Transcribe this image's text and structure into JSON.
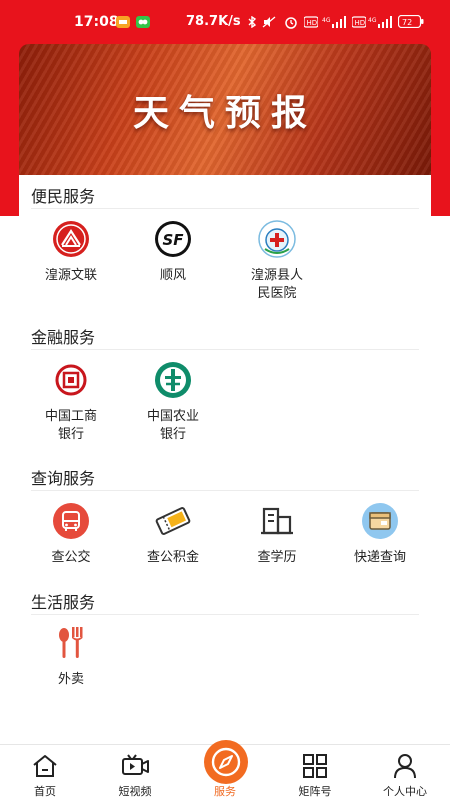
{
  "status_bar": {
    "time": "17:08",
    "right_text": "78.7K/s",
    "battery": "72"
  },
  "banner": {
    "title": "天气预报"
  },
  "sections": [
    {
      "title": "便民服务",
      "items": [
        {
          "label": "湟源文联",
          "icon": "federation-logo-icon"
        },
        {
          "label": "顺风",
          "icon": "sf-express-logo-icon"
        },
        {
          "label": "湟源县人民医院",
          "icon": "hospital-logo-icon"
        }
      ]
    },
    {
      "title": "金融服务",
      "items": [
        {
          "label": "中国工商银行",
          "icon": "icbc-logo-icon"
        },
        {
          "label": "中国农业银行",
          "icon": "abc-bank-logo-icon"
        }
      ]
    },
    {
      "title": "查询服务",
      "items": [
        {
          "label": "查公交",
          "icon": "bus-icon"
        },
        {
          "label": "查公积金",
          "icon": "fund-ticket-icon"
        },
        {
          "label": "查学历",
          "icon": "building-icon"
        },
        {
          "label": "快递查询",
          "icon": "package-icon"
        }
      ]
    },
    {
      "title": "生活服务",
      "items": [
        {
          "label": "外卖",
          "icon": "fork-spoon-icon"
        }
      ]
    }
  ],
  "tabs": [
    {
      "label": "首页",
      "icon": "home-icon"
    },
    {
      "label": "短视频",
      "icon": "video-icon"
    },
    {
      "label": "服务",
      "icon": "compass-icon"
    },
    {
      "label": "矩阵号",
      "icon": "grid-icon"
    },
    {
      "label": "个人中心",
      "icon": "person-icon"
    }
  ],
  "colors": {
    "brand_red": "#e8131c",
    "active_orange": "#f26b21",
    "bus_red": "#e64a3b",
    "abc_green": "#0f8c6a"
  }
}
